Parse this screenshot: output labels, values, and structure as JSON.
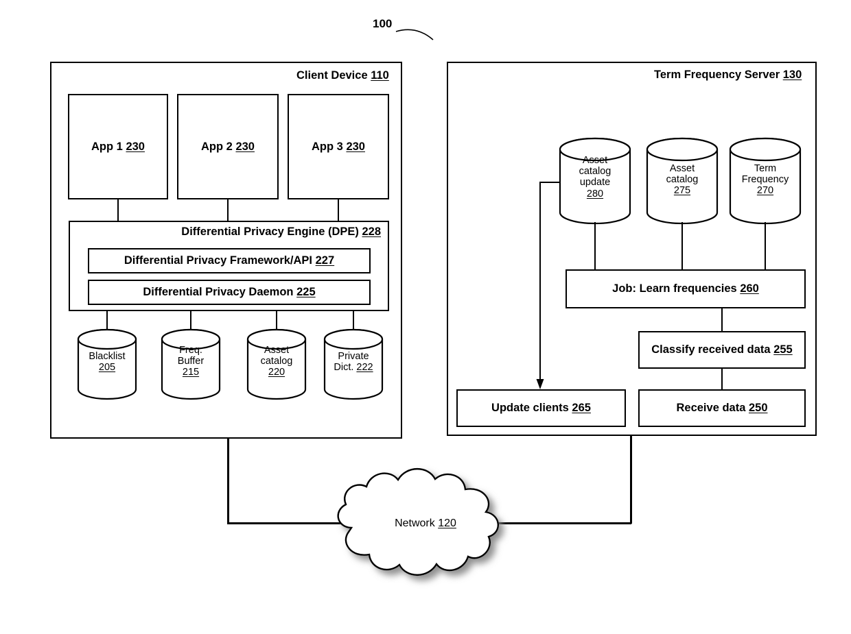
{
  "figure": {
    "number": "100"
  },
  "client_device": {
    "title_text": "Client Device",
    "title_ref": "110",
    "apps": [
      {
        "label": "App 1",
        "ref": "230"
      },
      {
        "label": "App 2",
        "ref": "230"
      },
      {
        "label": "App 3",
        "ref": "230"
      }
    ],
    "dpe": {
      "title_text": "Differential Privacy Engine (DPE)",
      "title_ref": "228",
      "rows": [
        {
          "label": "Differential Privacy Framework/API",
          "ref": "227"
        },
        {
          "label": "Differential Privacy Daemon",
          "ref": "225"
        }
      ]
    },
    "stores": [
      {
        "lines": [
          "Blacklist"
        ],
        "ref": "205",
        "ref_inline": false
      },
      {
        "lines": [
          "Freq.",
          "Buffer"
        ],
        "ref": "215",
        "ref_inline": false
      },
      {
        "lines": [
          "Asset",
          "catalog"
        ],
        "ref": "220",
        "ref_inline": false
      },
      {
        "lines": [
          "Private",
          "Dict."
        ],
        "ref": "222",
        "ref_inline": true
      }
    ]
  },
  "server": {
    "title_text": "Term Frequency Server",
    "title_ref": "130",
    "stores": [
      {
        "lines": [
          "Asset",
          "catalog",
          "update"
        ],
        "ref": "280"
      },
      {
        "lines": [
          "Asset",
          "catalog"
        ],
        "ref": "275"
      },
      {
        "lines": [
          "Term",
          "Frequency"
        ],
        "ref": "270"
      }
    ],
    "boxes": [
      {
        "label": "Job: Learn frequencies",
        "ref": "260"
      },
      {
        "label": "Classify received data",
        "ref": "255"
      },
      {
        "label": "Update clients",
        "ref": "265"
      },
      {
        "label": "Receive data",
        "ref": "250"
      }
    ]
  },
  "network": {
    "label": "Network",
    "ref": "120"
  },
  "colors": {
    "stroke": "#000000",
    "fill": "#ffffff",
    "shadow": "#9a9a9a"
  }
}
